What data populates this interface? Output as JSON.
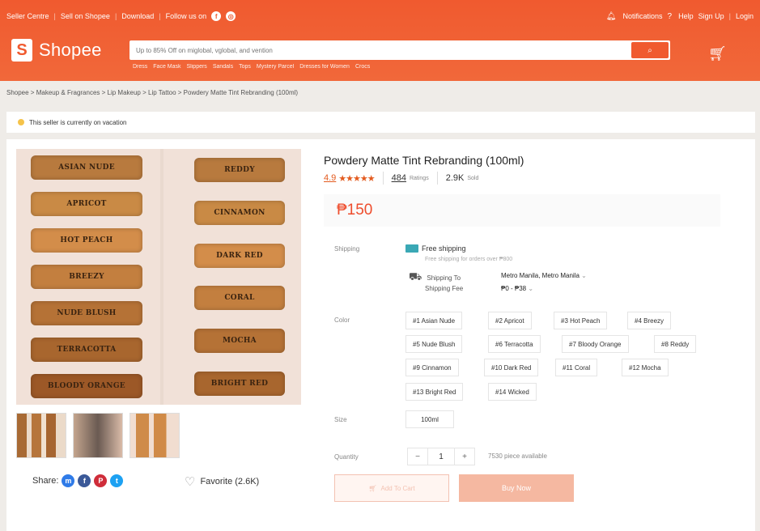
{
  "topnav": {
    "left": [
      "Seller Centre",
      "Sell on Shopee",
      "Download",
      "Follow us on"
    ],
    "right": [
      "Notifications",
      "Help",
      "Sign Up",
      "Login"
    ]
  },
  "header": {
    "logo_text": "Shopee",
    "search_placeholder": "Up to 85% Off on miglobal, vglobal, and vention",
    "search_icon": "search-icon",
    "suggestions": [
      "Dress",
      "Face Mask",
      "Slippers",
      "Sandals",
      "Tops",
      "Mystery Parcel",
      "Dresses for Women",
      "Crocs"
    ]
  },
  "breadcrumb": "Shopee > Makeup & Fragrances > Lip Makeup > Lip Tattoo > Powdery Matte Tint Rebranding (100ml)",
  "vacation_notice": "This seller is currently on vacation",
  "gallery": {
    "left_swatches": [
      "ASIAN NUDE",
      "APRICOT",
      "HOT PEACH",
      "BREEZY",
      "NUDE BLUSH",
      "TERRACOTTA",
      "BLOODY ORANGE"
    ],
    "right_swatches": [
      "REDDY",
      "CINNAMON",
      "DARK RED",
      "CORAL",
      "MOCHA",
      "BRIGHT RED"
    ],
    "swatch_colors": [
      "#b87a3e",
      "#c98a45",
      "#d38d4a",
      "#c37f3f",
      "#b57236",
      "#a8662e",
      "#9c5827"
    ],
    "share_label": "Share:",
    "social": [
      {
        "name": "messenger",
        "glyph": "m",
        "color": "#2f7be8"
      },
      {
        "name": "facebook",
        "glyph": "f",
        "color": "#3b5998"
      },
      {
        "name": "pinterest",
        "glyph": "P",
        "color": "#cf2d3a"
      },
      {
        "name": "twitter",
        "glyph": "t",
        "color": "#1da1f2"
      }
    ],
    "favorite": "Favorite (2.6K)"
  },
  "product": {
    "title": "Powdery Matte Tint Rebranding (100ml)",
    "rating": "4.9",
    "stars": 5,
    "ratings_count": "484",
    "ratings_label": "Ratings",
    "sold_count": "2.9K",
    "sold_label": "Sold",
    "price": "₱150"
  },
  "shipping": {
    "label": "Shipping",
    "free": "Free shipping",
    "free_sub": "Free shipping for orders over ₱800",
    "to_label": "Shipping To",
    "to_value": "Metro Manila, Metro Manila",
    "fee_label": "Shipping Fee",
    "fee_value": "₱0 - ₱38"
  },
  "options": {
    "color_label": "Color",
    "colors": [
      "#1 Asian Nude",
      "#2 Apricot",
      "#3 Hot Peach",
      "#4 Breezy",
      "#5 Nude Blush",
      "#6 Terracotta",
      "#7 Bloody Orange",
      "#8 Reddy",
      "#9 Cinnamon",
      "#10 Dark Red",
      "#11 Coral",
      "#12 Mocha",
      "#13 Bright Red",
      "#14 Wicked"
    ],
    "size_label": "Size",
    "size": "100ml",
    "quantity_label": "Quantity",
    "quantity": "1",
    "available": "7530 piece available"
  },
  "actions": {
    "add_to_cart": "Add To Cart",
    "buy_now": "Buy Now"
  }
}
